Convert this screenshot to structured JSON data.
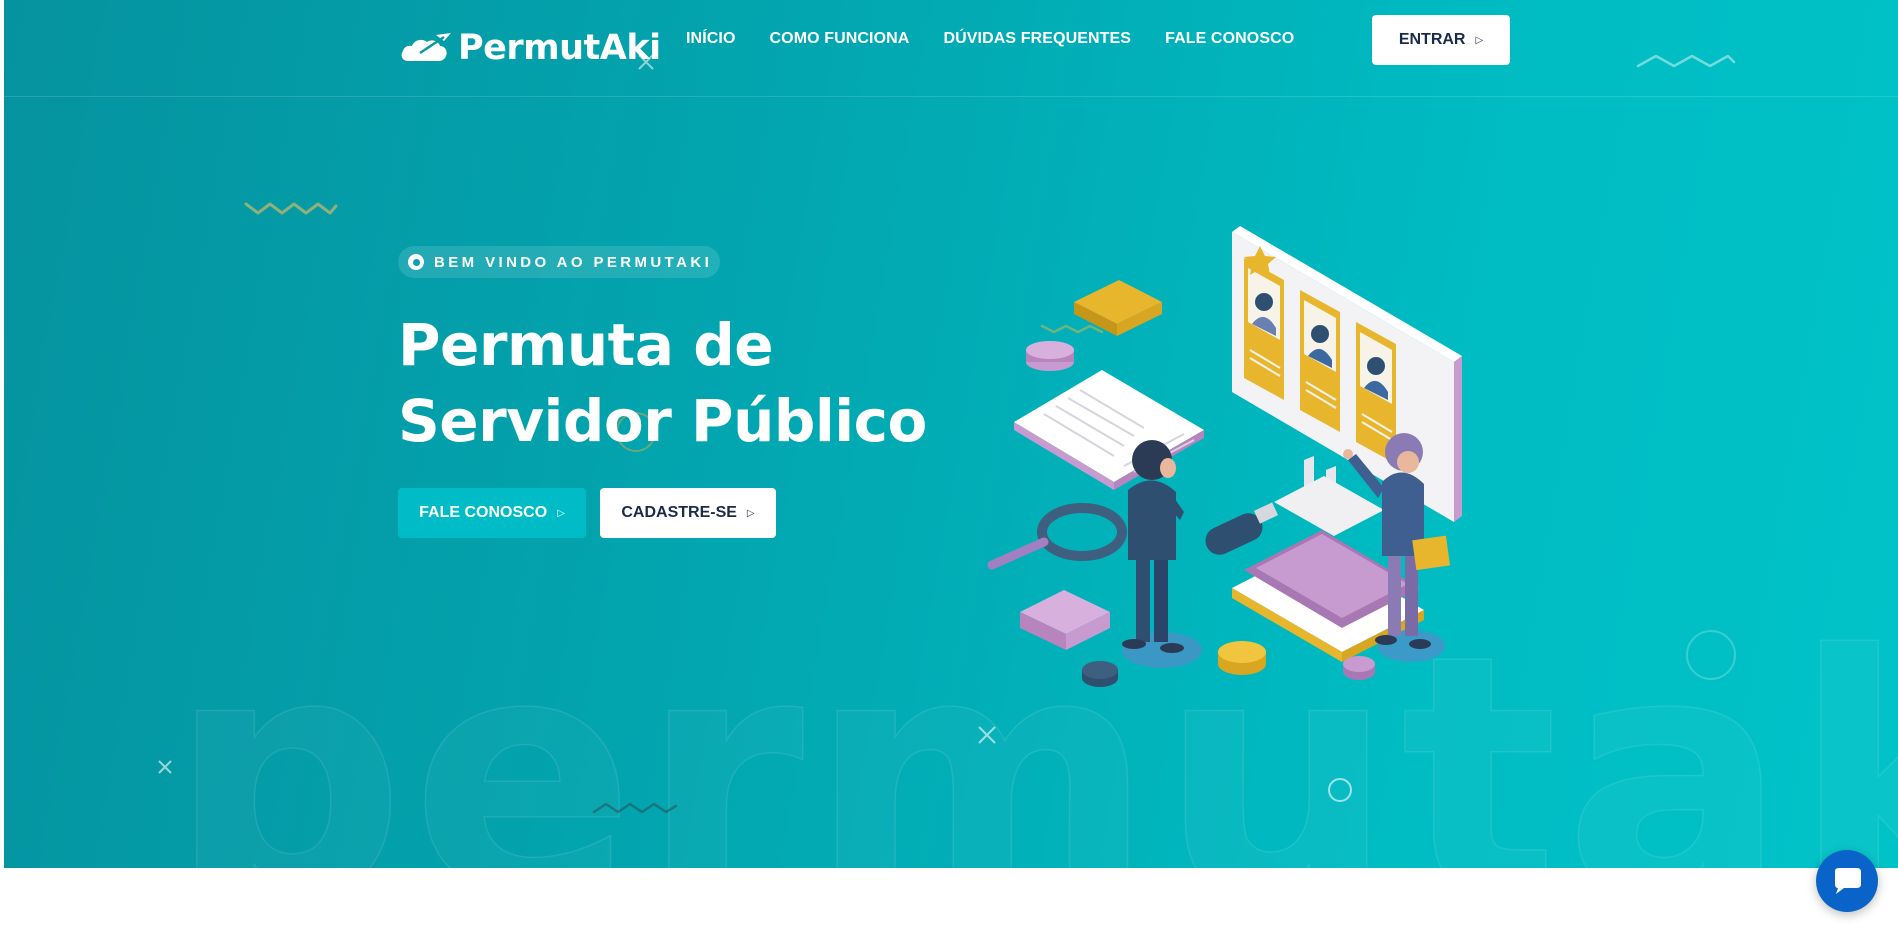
{
  "brand": {
    "name": "PermutAki"
  },
  "nav": {
    "links": [
      "INÍCIO",
      "COMO FUNCIONA",
      "DÚVIDAS FREQUENTES",
      "FALE CONOSCO"
    ],
    "login_label": "ENTRAR"
  },
  "hero": {
    "badge": "BEM VINDO AO PERMUTAKI",
    "title_line1": "Permuta de",
    "title_line2": "Servidor Público",
    "contact_label": "FALE CONOSCO",
    "signup_label": "CADASTRE-SE",
    "background_word": "permutaki"
  },
  "icons": {
    "logo": "cloud-plane-logo-icon",
    "caret": "caret-right-icon",
    "badge": "radio-dot-icon",
    "chat": "chat-bubble-icon"
  },
  "colors": {
    "hero_gradient_start": "#05939f",
    "hero_gradient_end": "#00c3c8",
    "cta_cyan": "#00bcc7",
    "button_text_dark": "#1b2b4a",
    "chat_blue": "#0a63c9"
  }
}
